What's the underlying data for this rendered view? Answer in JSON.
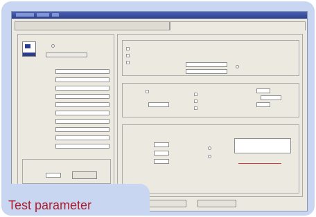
{
  "caption": "Test parameter",
  "titlebar": {
    "text": ""
  },
  "tabs": {
    "left": "",
    "right": ""
  },
  "left_panel": {
    "field_values": [
      "",
      "",
      "",
      "",
      "",
      "",
      "",
      "",
      "",
      ""
    ],
    "button_label": ""
  },
  "bottom_buttons": [
    "",
    ""
  ]
}
